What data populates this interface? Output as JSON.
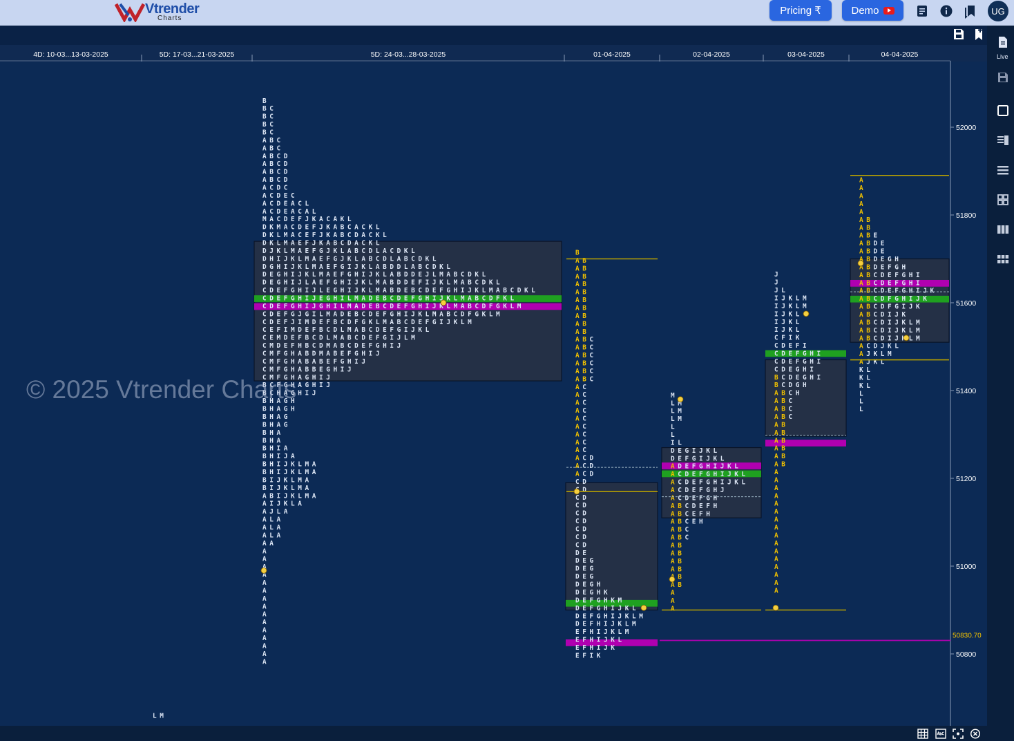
{
  "app": {
    "logo_text": "Vtrender",
    "logo_sub": "Charts",
    "pricing_label": "Pricing ₹",
    "demo_label": "Demo",
    "user_initials": "UG",
    "live_label": "Live",
    "watermark": "© 2025 Vtrender Charts"
  },
  "colors": {
    "background": "#0c2a55",
    "profile_box": "#243046",
    "letters": "#dde6f5",
    "ib_letters": "#f0c000",
    "poc": "#b000b0",
    "vpoc": "#1fa020",
    "levels": "#b8a000",
    "accent": "#2a66e0"
  },
  "chart_data": {
    "type": "market-profile",
    "instrument_unit": "price",
    "ylim": [
      50640,
      52300
    ],
    "yticks": [
      52000,
      51800,
      51600,
      51400,
      51200,
      51000,
      50800
    ],
    "last_price_label": "50830.70",
    "last_price": 50830.7,
    "tick": 18,
    "sessions": [
      {
        "label": "4D: 10-03...13-03-2025",
        "x0": 0,
        "x1": 205
      },
      {
        "label": "5D: 17-03...21-03-2025",
        "x0": 205,
        "x1": 365
      },
      {
        "label": "5D: 24-03...28-03-2025",
        "x0": 365,
        "x1": 817
      },
      {
        "label": "01-04-2025",
        "x0": 817,
        "x1": 955
      },
      {
        "label": "02-04-2025",
        "x0": 955,
        "x1": 1105
      },
      {
        "label": "03-04-2025",
        "x0": 1105,
        "x1": 1229
      },
      {
        "label": "04-04-2025",
        "x0": 1229,
        "x1": 1376
      }
    ],
    "profiles": [
      {
        "session": "5D: 24-03...28-03-2025",
        "x": 380,
        "top_price": 52061,
        "vah": 51740,
        "val": 51422,
        "poc_price": 51590,
        "vpoc_price": 51608,
        "ib_rows": 0,
        "rows": [
          "B",
          "BC",
          "BC",
          "BC",
          "BC",
          "ABC",
          "ABC",
          "ABCD",
          "ABCD",
          "ABCD",
          "ABCD",
          "ACDC",
          "ACDEC",
          "ACDEACL",
          "ACDEACAL",
          "MACDEFJKACAKL",
          "DKMACDEFJKABCACKL",
          "DKLMACEFJKABCDACKL",
          "DKLMAEFJKABCDACKL",
          "DJKLMAEFGJKLABCDLACDKL",
          "DHIJKLMAEFGJKLABCDLABCDKL",
          "DGHIJKLMAEFGIJKLABDDLABCDKL",
          "DEGHIJKLMAEFGHIJKLABDDEJLMABCDKL",
          "DEGHIJLAEFGHIJKLMABDDEFIJKLMABCDKL",
          "CDEFGHIJLEGHIJKLMABDEBCDEFGHIJKLMABCDKL",
          "CDEFGHIJEGHILMADEBCDEFGHIJKLMABCDFKL",
          "CDEFGHIJGHILMADEBCDEFGHIJKLMABCDFGKLM",
          "CDEFGJGILMADEBCDEFGHIJKLMABCDFGKLM",
          "CDEFJIMDEFBCDFGKLMABCDEFGIJKLM",
          "CEFIMDEFBCDLMABCDEFGIJKL",
          "CEMDEFBCDLMABCDEFGIJLM",
          "CMDEFHBCDMABCDEFGHIJ",
          "CMFGHABDMABEFGHIJ",
          "CMFGHABABEFGHIJ",
          "CMFGHABBEGHIJ",
          "CMFGHAGHIJ",
          "BCFGHAGHIJ",
          "BCHAGHIJ",
          "BHAGH",
          "BHAGH",
          "BHAG",
          "BHAG",
          "BHA",
          "BHA",
          "BHIA",
          "BHIJA",
          "BHIJKLMA",
          "BHIJKLMA",
          "BIJKLMA",
          "BIJKLMA",
          "ABIJKLMA",
          "AIJKLA",
          "AJLA",
          "ALA",
          "ALA",
          "ALA",
          "AA",
          "A",
          "A",
          "A",
          "A",
          "A",
          "A",
          "A",
          "A",
          "A",
          "A",
          "A",
          "A",
          "A",
          "A",
          "A"
        ]
      },
      {
        "session": "01-04-2025",
        "x": 833,
        "top_price": 51715,
        "vah": 51190,
        "val": 50900,
        "poc_price": 50824,
        "vpoc_price": 50914,
        "ib_rows": 0,
        "rows": [
          "B",
          "AB",
          "AB",
          "AB",
          "AB",
          "AB",
          "AB",
          "AB",
          "AB",
          "AB",
          "AB",
          "ABC",
          "ABC",
          "ABC",
          "ABC",
          "ABC",
          "ABC",
          "AC",
          "AC",
          "AC",
          "AC",
          "AC",
          "AC",
          "AC",
          "AC",
          "AC",
          "ACD",
          "ACD",
          "ACD",
          "CD",
          "CD",
          "CD",
          "CD",
          "CD",
          "CD",
          "CD",
          "CD",
          "CD",
          "DE",
          "DEG",
          "DEG",
          "DEG",
          "DEGH",
          "DEGHK",
          "DEFGHKM",
          "DEFGHIJKL",
          "DEFGHIJKLM",
          "DEFHIJKLM",
          "EFHIJKLM",
          "EFHIJKL",
          "EFHIJK",
          "EFIK"
        ]
      },
      {
        "session": "02-04-2025",
        "x": 971,
        "top_price": 51390,
        "vah": 51270,
        "val": 51110,
        "poc_price": 51227,
        "vpoc_price": 51209,
        "ib_rows": 0,
        "rows": [
          "M",
          "LM",
          "LM",
          "LM",
          "L",
          "L",
          "IL",
          "DEGIJKL",
          "DEFGIJKL",
          "ADEFGHIJKL",
          "ACDEFGHIJKL",
          "ACDEFGHIJKL",
          "ACDEFGHJ",
          "ACDEFGH",
          "ABCDEFH",
          "ABCEFH",
          "ABCEH",
          "ABC",
          "ABC",
          "AB",
          "AB",
          "AB",
          "AB",
          "AB",
          "AB",
          "A",
          "A",
          "A"
        ]
      },
      {
        "session": "03-04-2025",
        "x": 1121,
        "top_price": 51665,
        "vah": 51470,
        "val": 51296,
        "poc_price": 51279,
        "vpoc_price": 51483,
        "ib_rows": 0,
        "rows": [
          "J",
          "J",
          "JL",
          "IJKLM",
          "IJKLM",
          "IJKL",
          "IJKL",
          "IJKL",
          "CFIK",
          "CDEFI",
          "CDEFGHI",
          "CDEFGHI",
          "CDEGHI",
          "BCDEGHI",
          "BCDGH",
          "ABCH",
          "ABC",
          "ABC",
          "ABC",
          "AB",
          "AB",
          "AB",
          "AB",
          "AB",
          "AB",
          "A",
          "A",
          "A",
          "A",
          "A",
          "A",
          "A",
          "A",
          "A",
          "A",
          "A",
          "A",
          "A",
          "A",
          "A",
          "A"
        ]
      },
      {
        "session": "04-04-2025",
        "x": 1244,
        "top_price": 51880,
        "vah": 51700,
        "val": 51510,
        "poc_price": 51643,
        "vpoc_price": 51607,
        "ib_rows": 0,
        "rows": [
          "A",
          "A",
          "A",
          "A",
          "A",
          "AB",
          "AB",
          "ABE",
          "ABDE",
          "ABDE",
          "ABDEGH",
          "ABDEFGH",
          "ABCDEFGHI",
          "ABCDEFGHI",
          "ABCDEFGHIJK",
          "ABCDFGHIJK",
          "ABCDFGIJK",
          "ABCDIJK",
          "ABCDIJKLM",
          "ABCDIJKLM",
          "ABCDIJKLM",
          "ACDJKL",
          "AJKLM",
          "AJKL",
          "KL",
          "KL",
          "KL",
          "L",
          "L",
          "L"
        ]
      }
    ],
    "levels": [
      {
        "price": 51700,
        "x0": 820,
        "x1": 952
      },
      {
        "price": 51170,
        "x0": 820,
        "x1": 952
      },
      {
        "price": 50900,
        "x0": 958,
        "x1": 1102
      },
      {
        "price": 50900,
        "x0": 1108,
        "x1": 1225
      },
      {
        "price": 51890,
        "x0": 1231,
        "x1": 1374
      },
      {
        "price": 51470,
        "x0": 1231,
        "x1": 1374
      }
    ],
    "dashed_levels": [
      {
        "price": 51225,
        "x0": 820,
        "x1": 952
      },
      {
        "price": 51158,
        "x0": 958,
        "x1": 1102
      },
      {
        "price": 51298,
        "x0": 1108,
        "x1": 1225
      },
      {
        "price": 51625,
        "x0": 1231,
        "x1": 1374
      }
    ],
    "markers": [
      {
        "price": 51600,
        "x": 642
      },
      {
        "price": 50990,
        "x": 382
      },
      {
        "price": 51170,
        "x": 835
      },
      {
        "price": 50905,
        "x": 932
      },
      {
        "price": 51380,
        "x": 985
      },
      {
        "price": 50970,
        "x": 973
      },
      {
        "price": 51575,
        "x": 1167
      },
      {
        "price": 50905,
        "x": 1123
      },
      {
        "price": 51520,
        "x": 1312
      },
      {
        "price": 51690,
        "x": 1246
      }
    ],
    "stray_rows": [
      {
        "price": 50660,
        "x": 221,
        "text": "LM"
      }
    ]
  }
}
